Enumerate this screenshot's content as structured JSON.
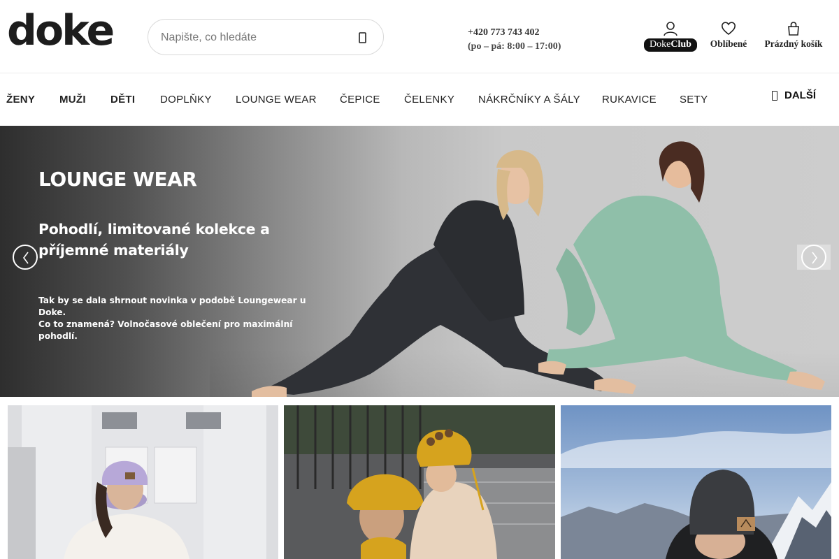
{
  "header": {
    "logo": "doke",
    "search": {
      "placeholder": "Napište, co hledáte",
      "icon": "search-icon"
    },
    "contact": {
      "phone": "+420 773 743 402",
      "hours": "(po – pá: 8:00 – 17:00)"
    },
    "club": {
      "prefix": "Doke",
      "suffix": "Club",
      "icon": "user-icon"
    },
    "favorites": {
      "label": "Oblíbené",
      "icon": "heart-icon"
    },
    "cart": {
      "label": "Prázdný košík",
      "icon": "bag-icon"
    }
  },
  "nav": {
    "items": [
      {
        "label": "ŽENY"
      },
      {
        "label": "MUŽI"
      },
      {
        "label": "DĚTI"
      },
      {
        "label": "DOPLŇKY"
      },
      {
        "label": "LOUNGE WEAR"
      },
      {
        "label": "ČEPICE"
      },
      {
        "label": "ČELENKY"
      },
      {
        "label": "NÁKRČNÍKY A ŠÁLY"
      },
      {
        "label": "RUKAVICE"
      },
      {
        "label": "SETY"
      }
    ],
    "more_label": "DALŠÍ",
    "more_icon": "menu-icon"
  },
  "hero": {
    "title": "LOUNGE WEAR",
    "subtitle": "Pohodlí, limitované kolekce a příjemné materiály",
    "text_line1": "Tak by se dala shrnout novinka v podobě Loungewear u Doke.",
    "text_line2": "Co to znamená? Volnočasové oblečení pro maximální pohodlí.",
    "prev_icon": "chevron-left-icon",
    "next_icon": "chevron-right-icon"
  },
  "colors": {
    "brand_dark": "#1d1d1d",
    "hoodie_dark": "#2f3136",
    "hoodie_mint": "#8fbfa9",
    "beanie_lilac": "#b7a8d8",
    "beanie_mustard": "#d6a31e",
    "beanie_grey": "#3a3c40"
  }
}
